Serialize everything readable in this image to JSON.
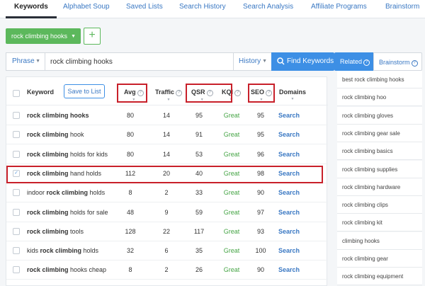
{
  "nav": {
    "tabs": [
      "Keywords",
      "Alphabet Soup",
      "Saved Lists",
      "Search History",
      "Search Analysis",
      "Affiliate Programs",
      "Brainstorm"
    ]
  },
  "list": {
    "name": "rock climbing hooks",
    "add_label": "+"
  },
  "search": {
    "mode": "Phrase",
    "query": "rock climbing hooks",
    "history_label": "History",
    "find_label": "Find Keywords"
  },
  "table": {
    "headers": {
      "keyword": "Keyword",
      "save": "Save to List",
      "avg": "Avg",
      "traffic": "Traffic",
      "qsr": "QSR",
      "kqi": "KQI",
      "seo": "SEO",
      "domains": "Domains"
    },
    "rows": [
      {
        "pre": "",
        "bold": "rock climbing hooks",
        "post": "",
        "avg": "80",
        "traffic": "14",
        "qsr": "95",
        "kqi": "Great",
        "seo": "95",
        "domains": "Search",
        "checked": false
      },
      {
        "pre": "",
        "bold": "rock climbing",
        "post": " hook",
        "avg": "80",
        "traffic": "14",
        "qsr": "91",
        "kqi": "Great",
        "seo": "95",
        "domains": "Search",
        "checked": false
      },
      {
        "pre": "",
        "bold": "rock climbing",
        "post": " holds for kids",
        "avg": "80",
        "traffic": "14",
        "qsr": "53",
        "kqi": "Great",
        "seo": "96",
        "domains": "Search",
        "checked": false
      },
      {
        "pre": "",
        "bold": "rock climbing",
        "post": " hand holds",
        "avg": "112",
        "traffic": "20",
        "qsr": "40",
        "kqi": "Great",
        "seo": "98",
        "domains": "Search",
        "checked": true
      },
      {
        "pre": "indoor ",
        "bold": "rock climbing",
        "post": " holds",
        "avg": "8",
        "traffic": "2",
        "qsr": "33",
        "kqi": "Great",
        "seo": "90",
        "domains": "Search",
        "checked": false
      },
      {
        "pre": "",
        "bold": "rock climbing",
        "post": " holds for sale",
        "avg": "48",
        "traffic": "9",
        "qsr": "59",
        "kqi": "Great",
        "seo": "97",
        "domains": "Search",
        "checked": false
      },
      {
        "pre": "",
        "bold": "rock climbing",
        "post": " tools",
        "avg": "128",
        "traffic": "22",
        "qsr": "117",
        "kqi": "Great",
        "seo": "93",
        "domains": "Search",
        "checked": false
      },
      {
        "pre": "kids ",
        "bold": "rock climbing",
        "post": " holds",
        "avg": "32",
        "traffic": "6",
        "qsr": "35",
        "kqi": "Great",
        "seo": "100",
        "domains": "Search",
        "checked": false
      },
      {
        "pre": "",
        "bold": "rock climbing",
        "post": " hooks cheap",
        "avg": "8",
        "traffic": "2",
        "qsr": "26",
        "kqi": "Great",
        "seo": "90",
        "domains": "Search",
        "checked": false
      }
    ]
  },
  "right_panel": {
    "tab_related": "Related",
    "tab_brainstorm": "Brainstorm",
    "items": [
      "best rock climbing hooks",
      "rock climbing hoo",
      "rock climbing gloves",
      "rock climbing gear sale",
      "rock climbing basics",
      "rock climbing supplies",
      "rock climbing hardware",
      "rock climbing clips",
      "rock climbing kit",
      "climbing hooks",
      "rock climbing gear",
      "rock climbing equipment"
    ]
  },
  "colors": {
    "accent_blue": "#3d8fe5",
    "link_blue": "#3a78c3",
    "green": "#5cb85c",
    "great_green": "#46a546",
    "highlight_red": "#c8202a"
  }
}
